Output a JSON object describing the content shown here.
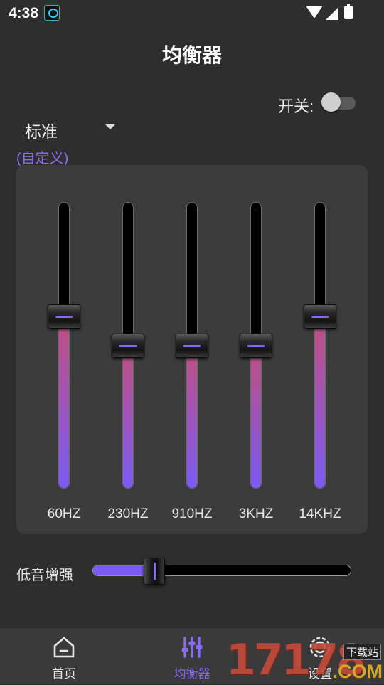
{
  "status_bar": {
    "time": "4:38"
  },
  "header": {
    "title": "均衡器"
  },
  "power_switch": {
    "label": "开关:",
    "state": "off"
  },
  "preset": {
    "selected": "标准",
    "custom_tag": "(自定义)"
  },
  "equalizer": {
    "bands": [
      {
        "label": "60HZ",
        "level": 0.6
      },
      {
        "label": "230HZ",
        "level": 0.5
      },
      {
        "label": "910HZ",
        "level": 0.5
      },
      {
        "label": "3KHZ",
        "level": 0.5
      },
      {
        "label": "14KHZ",
        "level": 0.6
      }
    ],
    "fill_colors": [
      "#c24f7e",
      "#7a5bf3"
    ]
  },
  "bass_boost": {
    "label": "低音增强",
    "level": 0.24
  },
  "nav": {
    "items": [
      {
        "label": "首页",
        "icon": "home-icon",
        "active": false
      },
      {
        "label": "均衡器",
        "icon": "equalizer-icon",
        "active": true
      },
      {
        "label": "设置",
        "icon": "settings-icon",
        "active": false
      }
    ]
  },
  "watermark": {
    "digits": "17178",
    "download": "下载站",
    "domain": ".COM"
  },
  "colors": {
    "accent": "#8a6bf5",
    "background": "#2e2e2f",
    "panel": "#3c3c3d"
  }
}
